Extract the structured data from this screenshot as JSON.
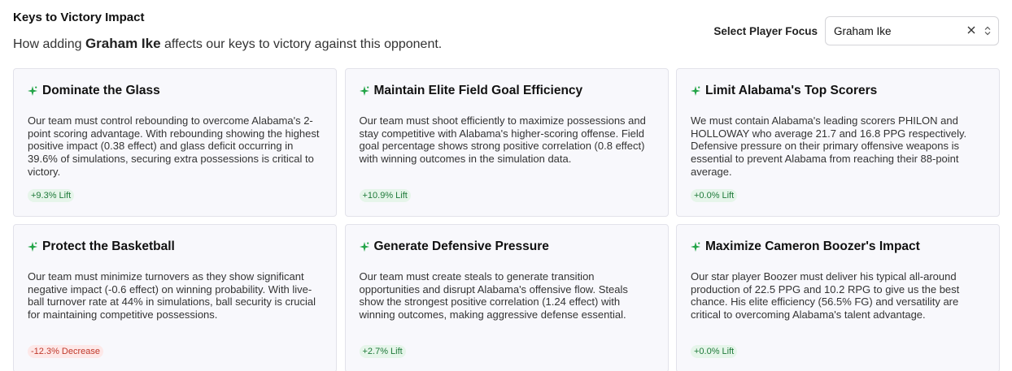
{
  "header": {
    "title": "Keys to Victory Impact",
    "subtitle_prefix": "How adding",
    "player_name": "Graham Ike",
    "subtitle_suffix": "affects our keys to victory against this opponent."
  },
  "focus": {
    "label": "Select Player Focus",
    "value": "Graham Ike"
  },
  "colors": {
    "accent_green": "#22a447",
    "positive_badge_bg": "#e6f5ea",
    "positive_badge_text": "#1f7a3a",
    "negative_badge_bg": "#fde8e8",
    "negative_badge_text": "#c0392b"
  },
  "cards": [
    {
      "title": "Dominate the Glass",
      "text": "Our team must control rebounding to overcome Alabama's 2-point scoring advantage. With rebounding showing the highest positive impact (0.38 effect) and glass deficit occurring in 39.6% of simulations, securing extra possessions is critical to victory.",
      "badge": "+9.3% Lift",
      "badge_type": "pos"
    },
    {
      "title": "Maintain Elite Field Goal Efficiency",
      "text": "Our team must shoot efficiently to maximize possessions and stay competitive with Alabama's higher-scoring offense. Field goal percentage shows strong positive correlation (0.8 effect) with winning outcomes in the simulation data.",
      "badge": "+10.9% Lift",
      "badge_type": "pos"
    },
    {
      "title": "Limit Alabama's Top Scorers",
      "text": "We must contain Alabama's leading scorers PHILON and HOLLOWAY who average 21.7 and 16.8 PPG respectively. Defensive pressure on their primary offensive weapons is essential to prevent Alabama from reaching their 88-point average.",
      "badge": "+0.0% Lift",
      "badge_type": "pos"
    },
    {
      "title": "Protect the Basketball",
      "text": "Our team must minimize turnovers as they show significant negative impact (-0.6 effect) on winning probability. With live-ball turnover rate at 44% in simulations, ball security is crucial for maintaining competitive possessions.",
      "badge": "-12.3% Decrease",
      "badge_type": "neg"
    },
    {
      "title": "Generate Defensive Pressure",
      "text": "Our team must create steals to generate transition opportunities and disrupt Alabama's offensive flow. Steals show the strongest positive correlation (1.24 effect) with winning outcomes, making aggressive defense essential.",
      "badge": "+2.7% Lift",
      "badge_type": "pos"
    },
    {
      "title": "Maximize Cameron Boozer's Impact",
      "text": "Our star player Boozer must deliver his typical all-around production of 22.5 PPG and 10.2 RPG to give us the best chance. His elite efficiency (56.5% FG) and versatility are critical to overcoming Alabama's talent advantage.",
      "badge": "+0.0% Lift",
      "badge_type": "pos"
    }
  ]
}
